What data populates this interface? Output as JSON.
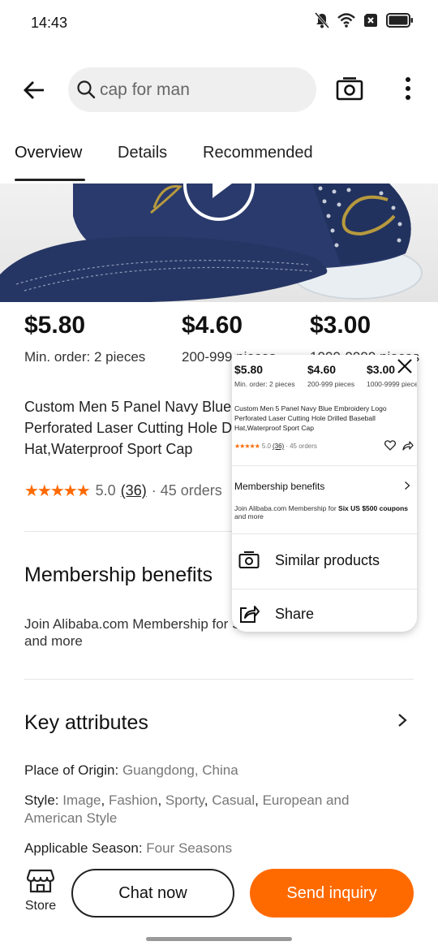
{
  "status_bar": {
    "time": "14:43",
    "icons": [
      "bell-off-icon",
      "wifi-icon",
      "sim-x-icon",
      "battery-icon"
    ]
  },
  "top_bar": {
    "search_text": "cap for man",
    "icons": [
      "back-arrow-icon",
      "search-icon",
      "camera-icon",
      "more-vert-icon"
    ]
  },
  "tabs": [
    {
      "label": "Overview",
      "active": true
    },
    {
      "label": "Details",
      "active": false
    },
    {
      "label": "Recommended",
      "active": false
    }
  ],
  "pricing": [
    {
      "price": "$5.80",
      "moq": "Min. order: 2 pieces"
    },
    {
      "price": "$4.60",
      "moq": "200-999 pieces"
    },
    {
      "price": "$3.00",
      "moq": "1000-9999 pieces"
    }
  ],
  "product": {
    "title_lines": [
      "Custom Men 5 Panel Navy Blue Embroidery Logo",
      "Perforated Laser Cutting Hole Drilled Baseball",
      "Hat,Waterproof Sport Cap"
    ],
    "stars": "★★★★★",
    "rating": "5.0",
    "review_count": "(36)",
    "orders": "· 45 orders"
  },
  "membership": {
    "title": "Membership benefits",
    "text_lines": [
      "Join Alibaba.com Membership for Six US $500 coupons",
      "and more"
    ]
  },
  "key_attributes": {
    "title": "Key attributes",
    "items": [
      {
        "label": "Place of Origin: ",
        "value": "Guangdong, China"
      },
      {
        "label": "Style: ",
        "value_parts": [
          "Image",
          ", ",
          "Fashion",
          ", ",
          "Sporty",
          ", ",
          "Casual",
          ", ",
          "European and American Style"
        ]
      },
      {
        "label": "Applicable Season: ",
        "value": "Four Seasons"
      }
    ]
  },
  "overlay": {
    "prices": [
      {
        "price": "$5.80",
        "moq": "Min. order: 2 pieces"
      },
      {
        "price": "$4.60",
        "moq": "200-999 pieces"
      },
      {
        "price": "$3.00",
        "moq": "1000-9999 pieces"
      }
    ],
    "title": "Custom Men 5 Panel Navy Blue Embroidery Logo Perforated Laser Cutting Hole Drilled Baseball Hat,Waterproof Sport Cap",
    "stars": "★★★★★",
    "rating": "5.0",
    "review_count": "(36)",
    "orders": "· 45 orders",
    "membership_title": "Membership benefits",
    "membership_prefix": "Join Alibaba.com Membership for ",
    "membership_bold": "Six US $500 coupons",
    "membership_suffix": " and more",
    "menu": [
      {
        "label": "Similar products",
        "icon": "camera-icon"
      },
      {
        "label": "Share",
        "icon": "share-icon"
      }
    ]
  },
  "bottom_bar": {
    "store_label": "Store",
    "chat_label": "Chat now",
    "inquiry_label": "Send inquiry"
  },
  "colors": {
    "accent": "#ff6a00",
    "cap_navy": "#2a3a6c",
    "embroidery_gold": "#b79a3e"
  }
}
